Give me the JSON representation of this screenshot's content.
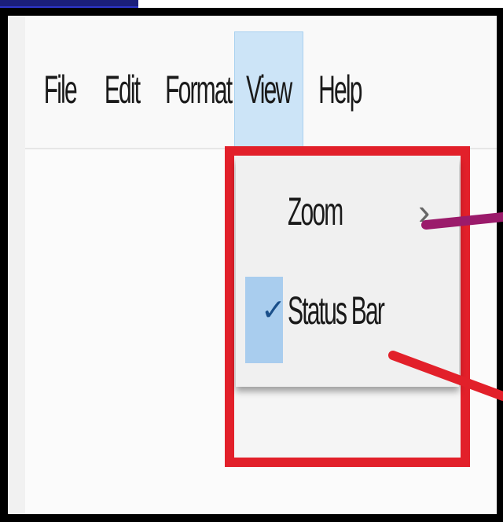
{
  "menubar": {
    "items": [
      "File",
      "Edit",
      "Format",
      "View",
      "Help"
    ],
    "active": "View"
  },
  "view_menu": {
    "items": [
      {
        "label": "Zoom",
        "has_submenu": true,
        "submenu_glyph": "›"
      },
      {
        "label": "Status Bar",
        "checked": true,
        "check_glyph": "✓"
      }
    ]
  },
  "colors": {
    "highlight_box": "#e2202a",
    "active_menu_bg": "#cce4f7",
    "arrow_zoom": "#9b1b6b",
    "arrow_status": "#e2202a"
  }
}
